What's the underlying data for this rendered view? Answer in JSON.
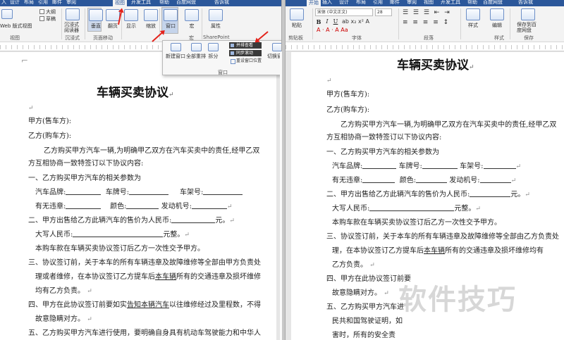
{
  "left": {
    "tabs": [
      "入",
      "设计",
      "布局",
      "引用",
      "邮件",
      "审阅",
      "视图",
      "开发工具",
      "帮助",
      "百度网盘",
      "告诉我"
    ],
    "active_tab_index": 6,
    "ribbon": {
      "web_layout": "Web 版式视图",
      "views_group": "视图",
      "checkbox_outline": "大纲",
      "checkbox_draft": "草稿",
      "immersive_reader": "沉浸式阅读器",
      "immersive_group": "沉浸式",
      "vertical": "垂直",
      "side_by_side": "翻页",
      "page_movement_group": "页面移动",
      "show": "显示",
      "zoom": "缩放",
      "window": "窗口",
      "macros": "宏",
      "macros_group": "宏",
      "properties": "属性",
      "sharepoint_group": "SharePoint"
    },
    "window_popup": {
      "new_window": "新建窗口",
      "arrange_all": "全部重排",
      "split": "拆分",
      "view_side_by_side": "并排查看",
      "sync_scrolling": "同步滚动",
      "reset_window_position": "重设窗口位置",
      "switch_windows": "切换窗口",
      "group_label": "窗口"
    },
    "doc": {
      "title": "车辆买卖协议",
      "seller": "甲方(售车方):",
      "buyer": "乙方(购车方):",
      "intro_1": "乙方购买甲方汽车一辆,为明确甲乙双方在汽车买卖中的责任,经甲乙双",
      "intro_2": "方互相协商一致特签订以下协议内容:",
      "clause1": "一、乙方购买甲方汽车的相关参数为",
      "brand": "汽车品牌:",
      "plate": "车牌号:",
      "frame": "车架号:",
      "violations": "有无违章:",
      "color": "颜色:",
      "engine": "发动机号:",
      "clause2": "二、甲方出售给乙方此辆汽车的售价为人民币:",
      "yuan": "元。",
      "uppercase": "大写人民币:",
      "yuan_full": "元整。",
      "one_time": "本购车款在车辆买卖协议签订后乙方一次性交予甲方。",
      "clause3_1": "三、协议签订前，关于本车的所有车辆违章及故障维修等全部由甲方负责处",
      "clause3_2a": "理或者维修，在本协议签订乙方提车后",
      "clause3_2_car": "本车辆",
      "clause3_2b": "所有的交通违章及损坏维修",
      "clause3_3": "均有乙方负责。",
      "clause4_1a": "四、甲方在此协议签订前要如实",
      "clause4_1u": "告知本辆汽车",
      "clause4_1b": "以往维修经过及里程数，不得",
      "clause4_2": "故意隐瞒对方。",
      "clause5": "五、乙方购买甲方汽车进行使用，要明确自身具有机动车驾驶能力和中华人"
    }
  },
  "right": {
    "tabs": [
      "开始",
      "插入",
      "设计",
      "布局",
      "引用",
      "邮件",
      "审阅",
      "视图",
      "开发工具",
      "帮助",
      "百度网盘",
      "告诉我"
    ],
    "active_tab_index": 0,
    "ribbon": {
      "paste": "粘贴",
      "clipboard_group": "剪贴板",
      "font_name": "宋体 (中文正文)",
      "font_size": "28",
      "bold": "B",
      "italic": "I",
      "underline": "U",
      "font_group": "字体",
      "paragraph_group": "段落",
      "styles": "样式",
      "styles_group": "样式",
      "editing": "编辑",
      "save_to_baidu": "保存到百度网盘",
      "save_group": "保存"
    },
    "doc": {
      "title": "车辆买卖协议",
      "seller": "甲方(售车方):",
      "buyer": "乙方(购车方):",
      "intro_1": "乙方购买甲方汽车一辆,为明确甲乙双方在汽车买卖中的责任,经甲乙双",
      "intro_2": "方互相协商一致特签订以下协议内容:",
      "clause1": "一、乙方购买甲方汽车的相关参数为",
      "brand": "汽车品牌:",
      "plate": "车牌号:",
      "frame": "车架号:",
      "violations": "有无违章:",
      "color": "颜色:",
      "engine": "发动机号:",
      "clause2": "二、甲方出售给乙方此辆汽车的售价为人民币:",
      "yuan": "元。",
      "uppercase": "大写人民币:",
      "yuan_full": "元整。",
      "one_time": "本购车款在车辆买卖协议签订后乙方一次性交予甲方。",
      "clause3_1": "三、协议签订前，关于本车的所有车辆违章及故障维修等全部由乙方负责处",
      "clause3_2a": "理，在本协议签订乙方提车后",
      "clause3_2_car": "本车辆",
      "clause3_2b": "所有的交通违章及损坏维修均有",
      "clause3_3": "乙方负责。",
      "clause4_1": "四、甲方在此协议签订前要",
      "clause4_2": "故意隐瞒对方。",
      "clause5_1": "五、乙方购买甲方汽车进",
      "clause5_2": "民共和国驾驶证明，如",
      "clause5_3": "害时，所有的安全责"
    }
  },
  "watermark": "软件技巧",
  "paragraph_mark": "↵",
  "colors": {
    "tab_bar": "#2b579a",
    "ribbon": "#f3f3f3",
    "arrow": "#e4231b",
    "watermark": "#969696"
  }
}
